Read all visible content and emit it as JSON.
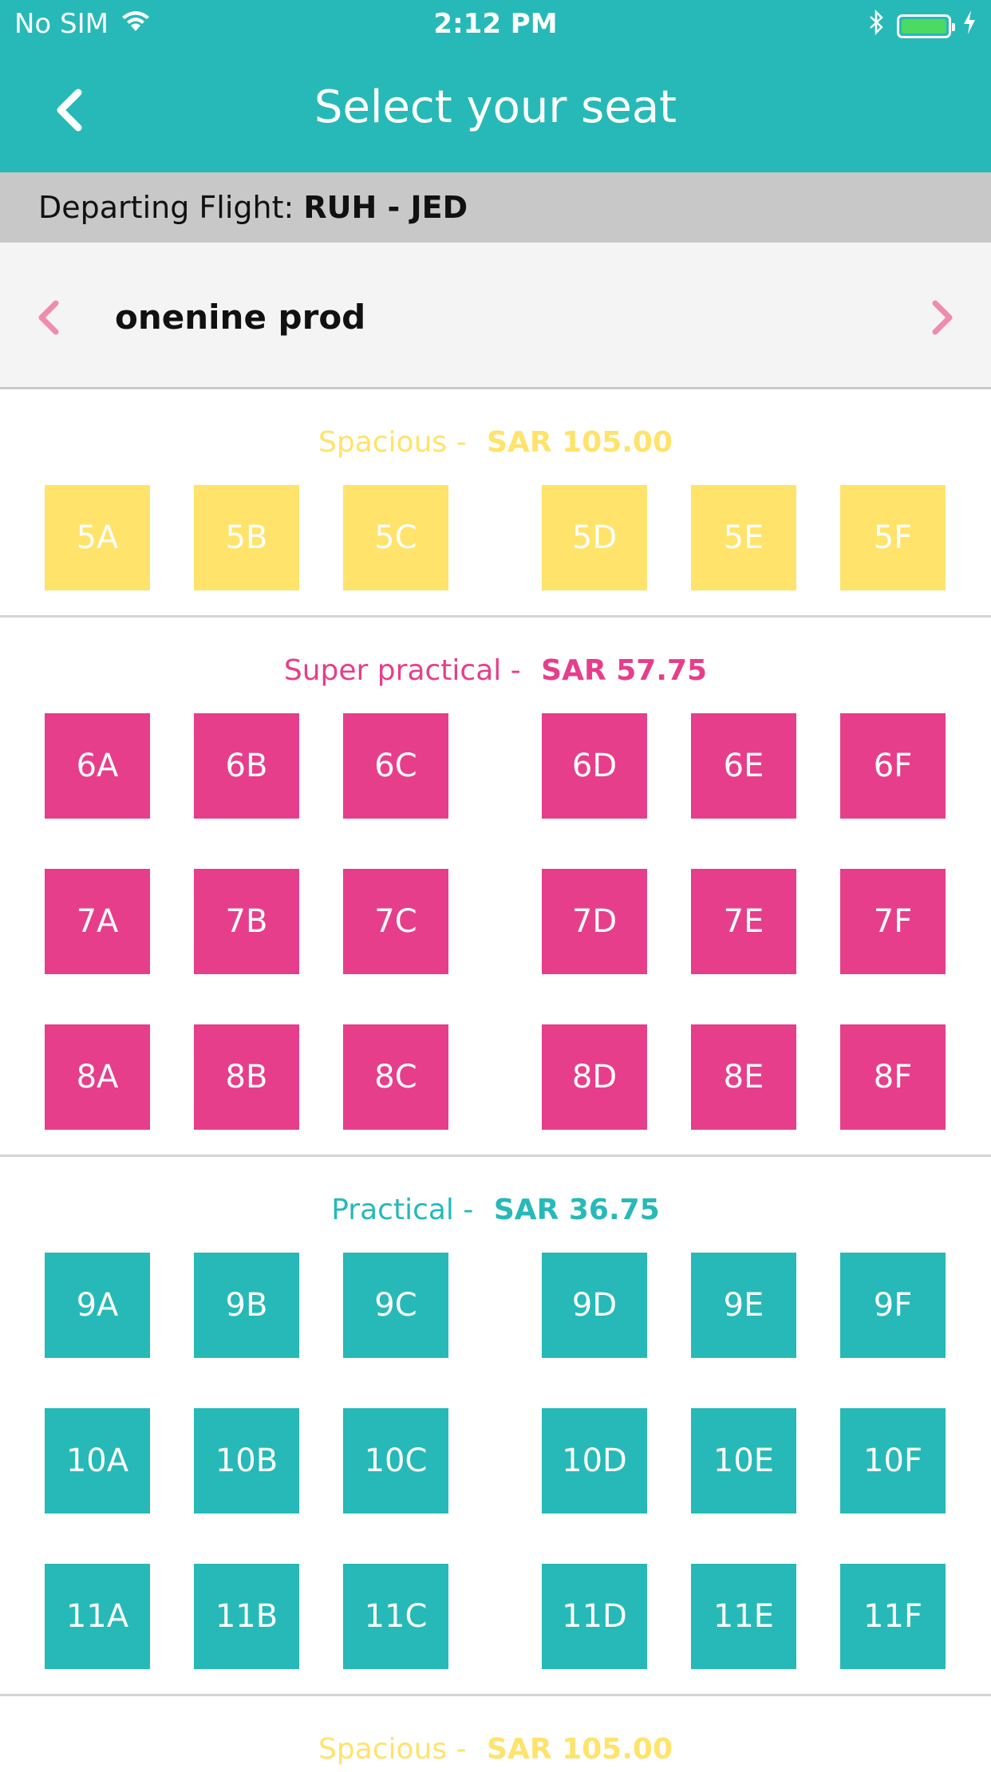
{
  "status_bar": {
    "carrier": "No SIM",
    "time": "2:12 PM"
  },
  "header": {
    "title": "Select your seat",
    "back_icon": "chevron-left-icon"
  },
  "flight": {
    "label": "Departing Flight: ",
    "route": "RUH - JED"
  },
  "passenger": {
    "name": "onenine prod",
    "prev_icon": "chevron-left-icon",
    "next_icon": "chevron-right-icon"
  },
  "colors": {
    "header": "#26b9b7",
    "spacious": "#ffe36b",
    "super_practical": "#e63e8b",
    "practical": "#26b9b7",
    "nav_arrow": "#f08bb0"
  },
  "sections": [
    {
      "name": "Spacious - ",
      "price": "SAR 105.00",
      "color": "#ffe36b",
      "rows": [
        [
          "5A",
          "5B",
          "5C",
          "5D",
          "5E",
          "5F"
        ]
      ]
    },
    {
      "name": "Super practical - ",
      "price": "SAR 57.75",
      "color": "#e63e8b",
      "rows": [
        [
          "6A",
          "6B",
          "6C",
          "6D",
          "6E",
          "6F"
        ],
        [
          "7A",
          "7B",
          "7C",
          "7D",
          "7E",
          "7F"
        ],
        [
          "8A",
          "8B",
          "8C",
          "8D",
          "8E",
          "8F"
        ]
      ]
    },
    {
      "name": "Practical - ",
      "price": "SAR 36.75",
      "color": "#26b9b7",
      "rows": [
        [
          "9A",
          "9B",
          "9C",
          "9D",
          "9E",
          "9F"
        ],
        [
          "10A",
          "10B",
          "10C",
          "10D",
          "10E",
          "10F"
        ],
        [
          "11A",
          "11B",
          "11C",
          "11D",
          "11E",
          "11F"
        ]
      ]
    },
    {
      "name": "Spacious - ",
      "price": "SAR 105.00",
      "color": "#ffe36b",
      "rows": []
    }
  ]
}
